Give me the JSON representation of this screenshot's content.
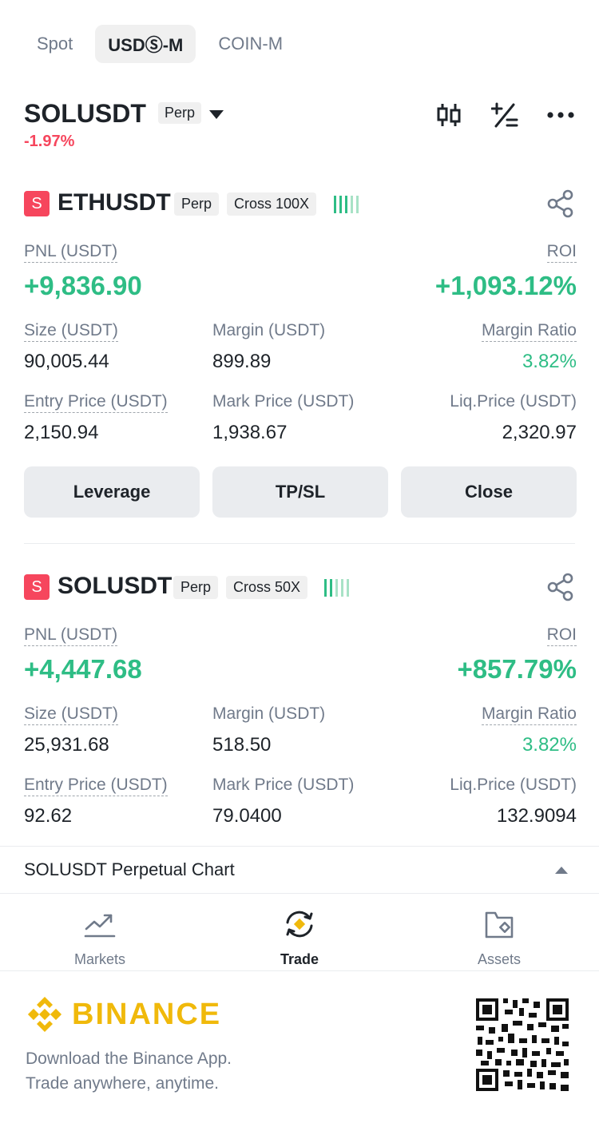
{
  "tabs": [
    {
      "label": "Spot",
      "active": false
    },
    {
      "label": "USDⓈ-M",
      "active": true
    },
    {
      "label": "COIN-M",
      "active": false
    }
  ],
  "header": {
    "symbol": "SOLUSDT",
    "tag": "Perp",
    "change": "-1.97%",
    "icons": [
      "candlestick-icon",
      "plus-minus-icon",
      "more-icon"
    ]
  },
  "positions": [
    {
      "side_badge": "S",
      "symbol": "ETHUSDT",
      "type_tag": "Perp",
      "margin_tag": "Cross 100X",
      "pnl_label": "PNL (USDT)",
      "pnl_value": "+9,836.90",
      "roi_label": "ROI",
      "roi_value": "+1,093.12%",
      "size_label": "Size (USDT)",
      "size_value": "90,005.44",
      "margin_label": "Margin (USDT)",
      "margin_value": "899.89",
      "ratio_label": "Margin Ratio",
      "ratio_value": "3.82%",
      "entry_label": "Entry Price (USDT)",
      "entry_value": "2,150.94",
      "mark_label": "Mark Price (USDT)",
      "mark_value": "1,938.67",
      "liq_label": "Liq.Price (USDT)",
      "liq_value": "2,320.97",
      "buttons": [
        "Leverage",
        "TP/SL",
        "Close"
      ]
    },
    {
      "side_badge": "S",
      "symbol": "SOLUSDT",
      "type_tag": "Perp",
      "margin_tag": "Cross 50X",
      "pnl_label": "PNL (USDT)",
      "pnl_value": "+4,447.68",
      "roi_label": "ROI",
      "roi_value": "+857.79%",
      "size_label": "Size (USDT)",
      "size_value": "25,931.68",
      "margin_label": "Margin (USDT)",
      "margin_value": "518.50",
      "ratio_label": "Margin Ratio",
      "ratio_value": "3.82%",
      "entry_label": "Entry Price (USDT)",
      "entry_value": "92.62",
      "mark_label": "Mark Price (USDT)",
      "mark_value": "79.0400",
      "liq_label": "Liq.Price (USDT)",
      "liq_value": "132.9094"
    }
  ],
  "chart_bar": {
    "label": "SOLUSDT Perpetual  Chart"
  },
  "nav": [
    {
      "label": "Markets",
      "icon": "markets-chart-icon",
      "active": false
    },
    {
      "label": "Trade",
      "icon": "trade-icon",
      "active": true
    },
    {
      "label": "Assets",
      "icon": "wallet-icon",
      "active": false
    }
  ],
  "footer": {
    "brand": "BINANCE",
    "tagline_1": "Download the Binance App.",
    "tagline_2": "Trade anywhere, anytime."
  },
  "colors": {
    "positive": "#2ebd85",
    "negative": "#f6465d",
    "brand": "#f0b90b",
    "text_primary": "#1e2329",
    "text_secondary": "#707a8a"
  }
}
